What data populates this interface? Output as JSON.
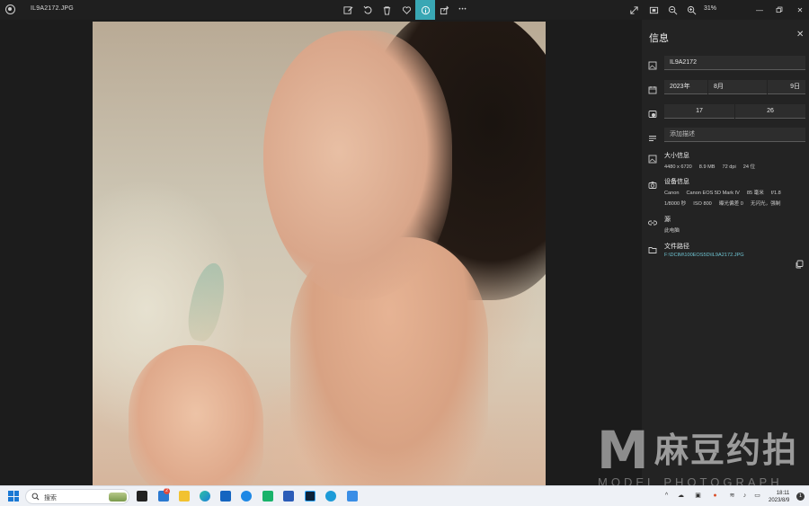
{
  "window": {
    "filename": "IL9A2172.JPG",
    "zoom": "31%"
  },
  "toolbar": {
    "edit_icon": "edit-image-icon",
    "rotate_icon": "rotate-icon",
    "delete_icon": "trash-icon",
    "favorite_icon": "heart-icon",
    "info_icon": "info-icon",
    "share_icon": "share-icon",
    "more_icon": "more-icon",
    "more_glyph": "•••",
    "active_color": "#39a7b4"
  },
  "info_panel": {
    "title": "信息",
    "file_name_value": "IL9A2172",
    "date": {
      "year": "2023年",
      "month": "8月",
      "day": "9日"
    },
    "time": {
      "hour": "17",
      "minute": "26"
    },
    "description_placeholder": "添加描述",
    "size": {
      "label": "大小信息",
      "dimensions": "4480 x 6720",
      "filesize": "8.9 MB",
      "dpi": "72 dpi",
      "bit": "24 位"
    },
    "device": {
      "label": "设备信息",
      "make": "Canon",
      "model": "Canon EOS 5D Mark IV",
      "focal": "85 毫米",
      "aperture": "f/1.8",
      "shutter": "1/8000 秒",
      "iso": "ISO 800",
      "exposure": "曝光偏差 0",
      "flash": "无闪光，强制"
    },
    "source": {
      "label": "源",
      "value": "此电脑"
    },
    "path": {
      "label": "文件路径",
      "value": "F:\\DCIM\\100EOS5D\\IL9A2172.JPG"
    }
  },
  "watermark": {
    "letter": "M",
    "chinese": "麻豆约拍",
    "english": "MODEL PHOTOGRAPH"
  },
  "taskbar": {
    "search_placeholder": "搜索",
    "mail_badge": "2",
    "time": "18:11",
    "date": "2023/8/9",
    "notifications": "1"
  }
}
